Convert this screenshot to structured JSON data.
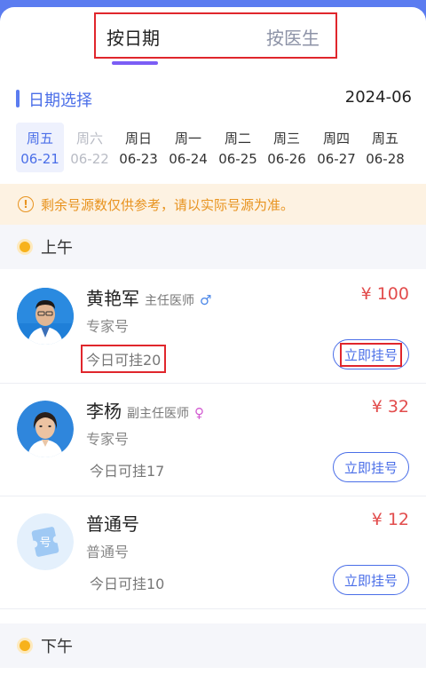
{
  "tabs": [
    {
      "label": "按日期",
      "active": true
    },
    {
      "label": "按医生",
      "active": false
    }
  ],
  "date_select": {
    "title": "日期选择",
    "month": "2024-06",
    "days": [
      {
        "weekday": "周五",
        "date": "06-21",
        "state": "selected"
      },
      {
        "weekday": "周六",
        "date": "06-22",
        "state": "disabled"
      },
      {
        "weekday": "周日",
        "date": "06-23",
        "state": "normal"
      },
      {
        "weekday": "周一",
        "date": "06-24",
        "state": "normal"
      },
      {
        "weekday": "周二",
        "date": "06-25",
        "state": "normal"
      },
      {
        "weekday": "周三",
        "date": "06-26",
        "state": "normal"
      },
      {
        "weekday": "周四",
        "date": "06-27",
        "state": "normal"
      },
      {
        "weekday": "周五",
        "date": "06-28",
        "state": "normal"
      }
    ]
  },
  "notice": {
    "icon": "exclamation-circle-icon",
    "text": "剩余号源数仅供参考，请以实际号源为准。"
  },
  "morning": {
    "label": "上午",
    "doctors": [
      {
        "name": "黄艳军",
        "title": "主任医师",
        "gender": "♂",
        "type": "专家号",
        "remaining": "今日可挂20",
        "price": "¥ 100",
        "button": "立即挂号"
      },
      {
        "name": "李杨",
        "title": "副主任医师",
        "gender": "♀",
        "type": "专家号",
        "remaining": "今日可挂17",
        "price": "¥ 32",
        "button": "立即挂号"
      },
      {
        "name": "普通号",
        "title": "",
        "gender": "",
        "type": "普通号",
        "remaining": "今日可挂10",
        "price": "¥ 12",
        "button": "立即挂号"
      }
    ]
  },
  "afternoon": {
    "label": "下午"
  },
  "colors": {
    "accent": "#4a6ee8",
    "price": "#e24c4c",
    "notice": "#e8931f",
    "header": "#5b7cf0"
  }
}
